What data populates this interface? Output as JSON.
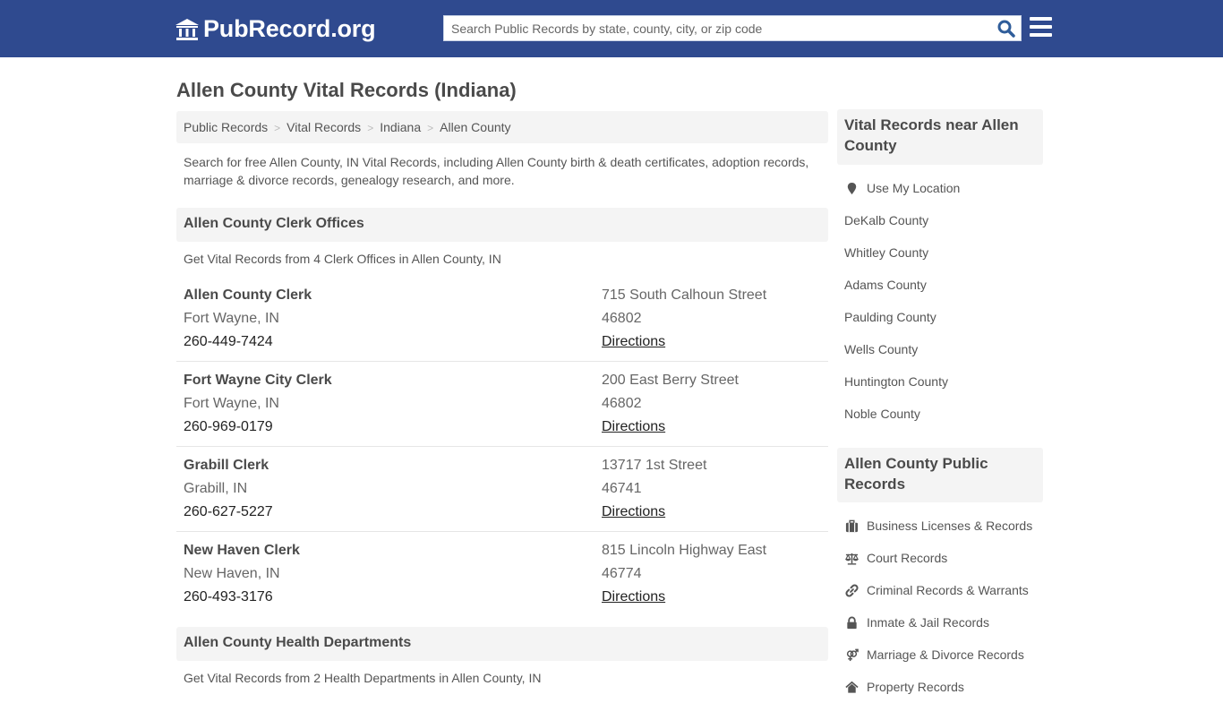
{
  "header": {
    "brand": "PubRecord.org",
    "search_placeholder": "Search Public Records by state, county, city, or zip code"
  },
  "page_title": "Allen County Vital Records (Indiana)",
  "breadcrumb": [
    "Public Records",
    "Vital Records",
    "Indiana",
    "Allen County"
  ],
  "intro": "Search for free Allen County, IN Vital Records, including Allen County birth & death certificates, adoption records, marriage & divorce records, genealogy research, and more.",
  "clerk_section": {
    "title": "Allen County Clerk Offices",
    "subtitle": "Get Vital Records from 4 Clerk Offices in Allen County, IN",
    "offices": [
      {
        "name": "Allen County Clerk",
        "city": "Fort Wayne, IN",
        "phone": "260-449-7424",
        "address": "715 South Calhoun Street",
        "zip": "46802",
        "link": "Directions"
      },
      {
        "name": "Fort Wayne City Clerk",
        "city": "Fort Wayne, IN",
        "phone": "260-969-0179",
        "address": "200 East Berry Street",
        "zip": "46802",
        "link": "Directions"
      },
      {
        "name": "Grabill Clerk",
        "city": "Grabill, IN",
        "phone": "260-627-5227",
        "address": "13717 1st Street",
        "zip": "46741",
        "link": "Directions"
      },
      {
        "name": "New Haven Clerk",
        "city": "New Haven, IN",
        "phone": "260-493-3176",
        "address": "815 Lincoln Highway East",
        "zip": "46774",
        "link": "Directions"
      }
    ]
  },
  "health_section": {
    "title": "Allen County Health Departments",
    "subtitle": "Get Vital Records from 2 Health Departments in Allen County, IN"
  },
  "sidebar": {
    "nearby": {
      "title": "Vital Records near Allen County",
      "use_location": "Use My Location",
      "items": [
        "DeKalb County",
        "Whitley County",
        "Adams County",
        "Paulding County",
        "Wells County",
        "Huntington County",
        "Noble County"
      ]
    },
    "public_records": {
      "title": "Allen County Public Records",
      "items": [
        {
          "label": "Business Licenses & Records",
          "icon": "briefcase-icon"
        },
        {
          "label": "Court Records",
          "icon": "balance-scale-icon"
        },
        {
          "label": "Criminal Records & Warrants",
          "icon": "link-icon"
        },
        {
          "label": "Inmate & Jail Records",
          "icon": "lock-icon"
        },
        {
          "label": "Marriage & Divorce Records",
          "icon": "venus-mars-icon"
        },
        {
          "label": "Property Records",
          "icon": "home-icon"
        }
      ]
    }
  }
}
